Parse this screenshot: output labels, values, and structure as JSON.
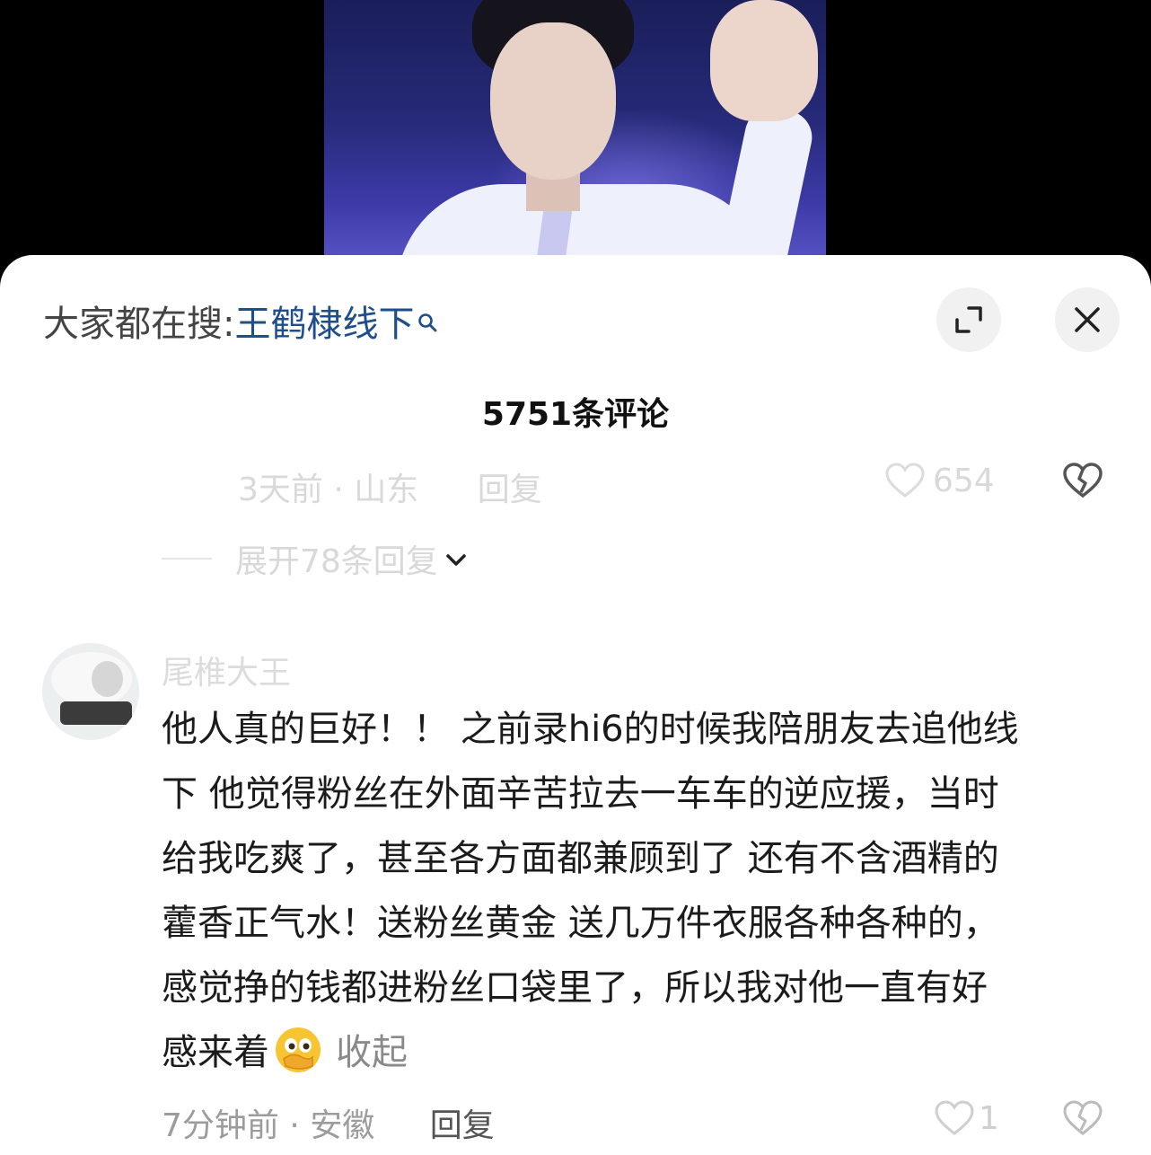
{
  "search": {
    "prefix": "大家都在搜:",
    "term": "王鹤棣线下"
  },
  "comments_header": {
    "count_title": "5751条评论"
  },
  "previous_comment": {
    "time_location": "3天前 · 山东",
    "reply_label": "回复",
    "like_count": "654",
    "expand_replies_label": "展开78条回复"
  },
  "comment": {
    "username": "尾椎大王",
    "lines": [
      "他人真的巨好！！ 之前录hi6的时候我陪朋友去追他线",
      "下 他觉得粉丝在外面辛苦拉去一车车的逆应援，当时",
      "给我吃爽了，甚至各方面都兼顾到了 还有不含酒精的",
      "藿香正气水！送粉丝黄金 送几万件衣服各种各种的，",
      "感觉挣的钱都进粉丝口袋里了，所以我对他一直有好",
      "感来着"
    ],
    "emoji": "face-with-hand-over-mouth-emoji",
    "collapse_label": "收起",
    "time_location": "7分钟前 · 安徽",
    "reply_label": "回复",
    "like_count": "1"
  },
  "colors": {
    "search_term": "#1f4f8a",
    "text": "#1b1b1b",
    "meta": "#9c9c9c",
    "faded": "#d9d9d9"
  }
}
